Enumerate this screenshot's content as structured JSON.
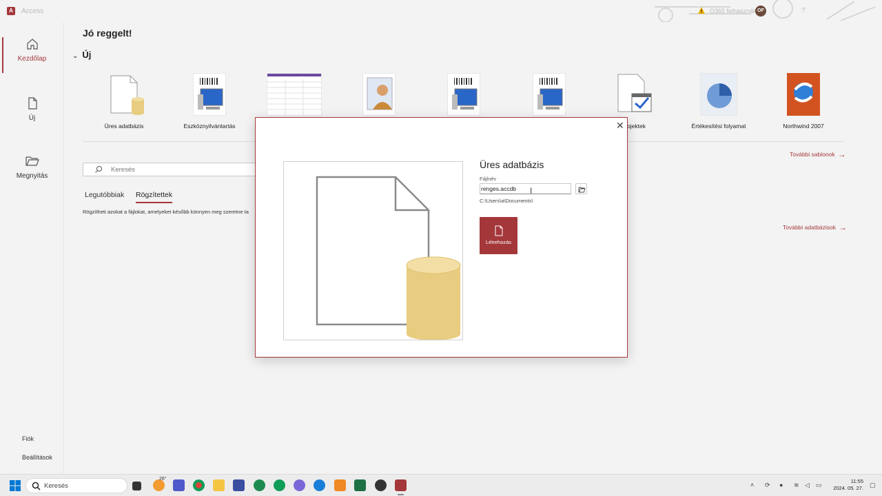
{
  "titlebar": {
    "app_name": "Access",
    "user_name": "O365 felhasználó",
    "user_initials": "OF",
    "help": "?"
  },
  "sidebar": {
    "items": [
      {
        "label": "Kezdőlap"
      },
      {
        "label": "Új"
      },
      {
        "label": "Megnyitás"
      }
    ],
    "account": "Fiók",
    "settings": "Beállítások"
  },
  "main": {
    "greeting": "Jó reggelt!",
    "new_section": "Új",
    "templates": [
      {
        "label": "Üres adatbázis"
      },
      {
        "label": "Eszköznyilvántartás"
      },
      {
        "label": ""
      },
      {
        "label": ""
      },
      {
        "label": ""
      },
      {
        "label": ""
      },
      {
        "label": "rojektek"
      },
      {
        "label": "Értékesítési folyamat"
      },
      {
        "label": "Northwind 2007"
      }
    ],
    "more_templates": "További sablonok",
    "search_placeholder": "Keresés",
    "tabs": [
      {
        "label": "Legutóbbiak"
      },
      {
        "label": "Rögzítettek"
      }
    ],
    "pinned_info": "Rögzítheti azokat a fájlokat, amelyeket később könnyen meg szeretne ta",
    "more_databases": "További adatbázisok"
  },
  "dialog": {
    "title": "Üres adatbázis",
    "filename_label": "Fájlnév",
    "filename_value": "renges.accdb",
    "path": "C:\\Users\\a\\Documents\\",
    "create_label": "Létrehozás"
  },
  "taskbar": {
    "search_label": "Keresés",
    "weather_temp": "26°",
    "time": "11:55",
    "date": "2024. 05. 27."
  },
  "colors": {
    "accent": "#a4373a",
    "db_cylinder": "#e8cc7f"
  }
}
